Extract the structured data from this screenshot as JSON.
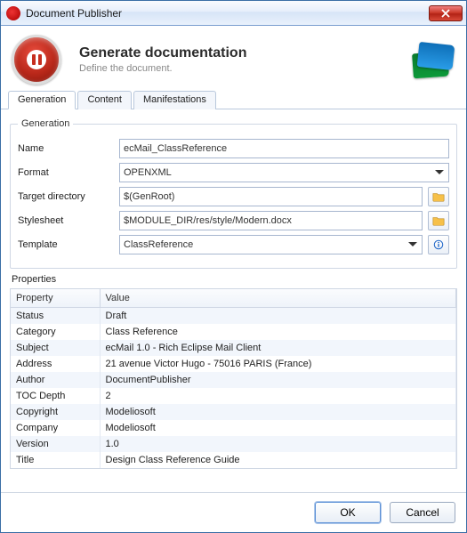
{
  "app": {
    "title": "Document Publisher"
  },
  "header": {
    "title": "Generate documentation",
    "subtitle": "Define the document."
  },
  "tabs": [
    {
      "label": "Generation",
      "active": true
    },
    {
      "label": "Content",
      "active": false
    },
    {
      "label": "Manifestations",
      "active": false
    }
  ],
  "generation": {
    "legend": "Generation",
    "name": {
      "label": "Name",
      "value": "ecMail_ClassReference"
    },
    "format": {
      "label": "Format",
      "value": "OPENXML"
    },
    "target_dir": {
      "label": "Target directory",
      "value": "$(GenRoot)"
    },
    "stylesheet": {
      "label": "Stylesheet",
      "value": "$MODULE_DIR/res/style/Modern.docx"
    },
    "template": {
      "label": "Template",
      "value": "ClassReference"
    }
  },
  "properties": {
    "label": "Properties",
    "columns": [
      "Property",
      "Value"
    ],
    "rows": [
      {
        "prop": "Status",
        "val": "Draft"
      },
      {
        "prop": "Category",
        "val": "Class Reference"
      },
      {
        "prop": "Subject",
        "val": "ecMail 1.0 - Rich Eclipse Mail Client"
      },
      {
        "prop": "Address",
        "val": "21 avenue Victor Hugo - 75016 PARIS (France)"
      },
      {
        "prop": "Author",
        "val": "DocumentPublisher"
      },
      {
        "prop": "TOC Depth",
        "val": "2"
      },
      {
        "prop": "Copyright",
        "val": "Modeliosoft"
      },
      {
        "prop": "Company",
        "val": "Modeliosoft"
      },
      {
        "prop": "Version",
        "val": "1.0"
      },
      {
        "prop": "Title",
        "val": "Design Class Reference Guide"
      }
    ]
  },
  "footer": {
    "ok": "OK",
    "cancel": "Cancel"
  }
}
